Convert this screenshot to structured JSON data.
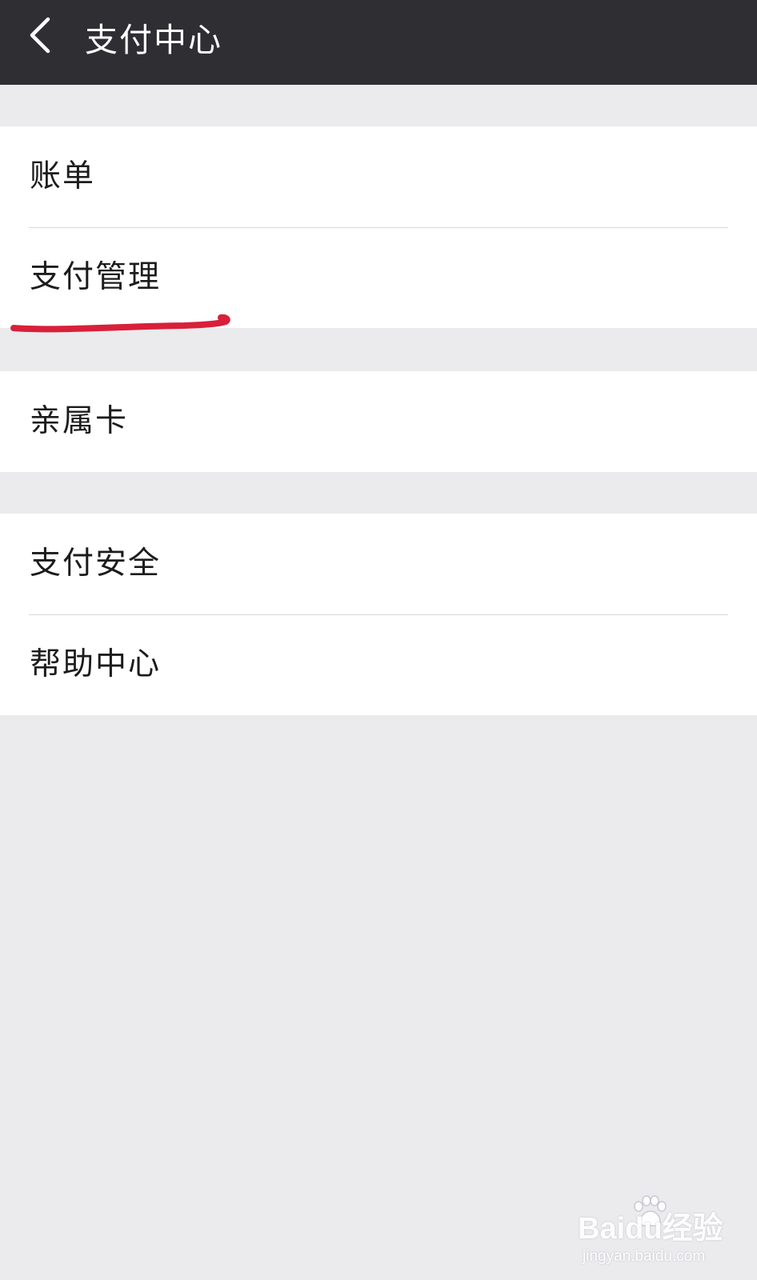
{
  "header": {
    "title": "支付中心",
    "back_icon": "chevron-left-icon",
    "background": "#2f2e33"
  },
  "menu": {
    "group1": [
      {
        "label": "账单"
      },
      {
        "label": "支付管理",
        "annotated": true
      }
    ],
    "group2": [
      {
        "label": "亲属卡"
      }
    ],
    "group3": [
      {
        "label": "支付安全"
      },
      {
        "label": "帮助中心"
      }
    ]
  },
  "annotation": {
    "color": "#d8203a",
    "shape": "hand-drawn underline"
  },
  "watermark": {
    "logo": "Baidu经验",
    "url": "jingyan.baidu.com"
  }
}
